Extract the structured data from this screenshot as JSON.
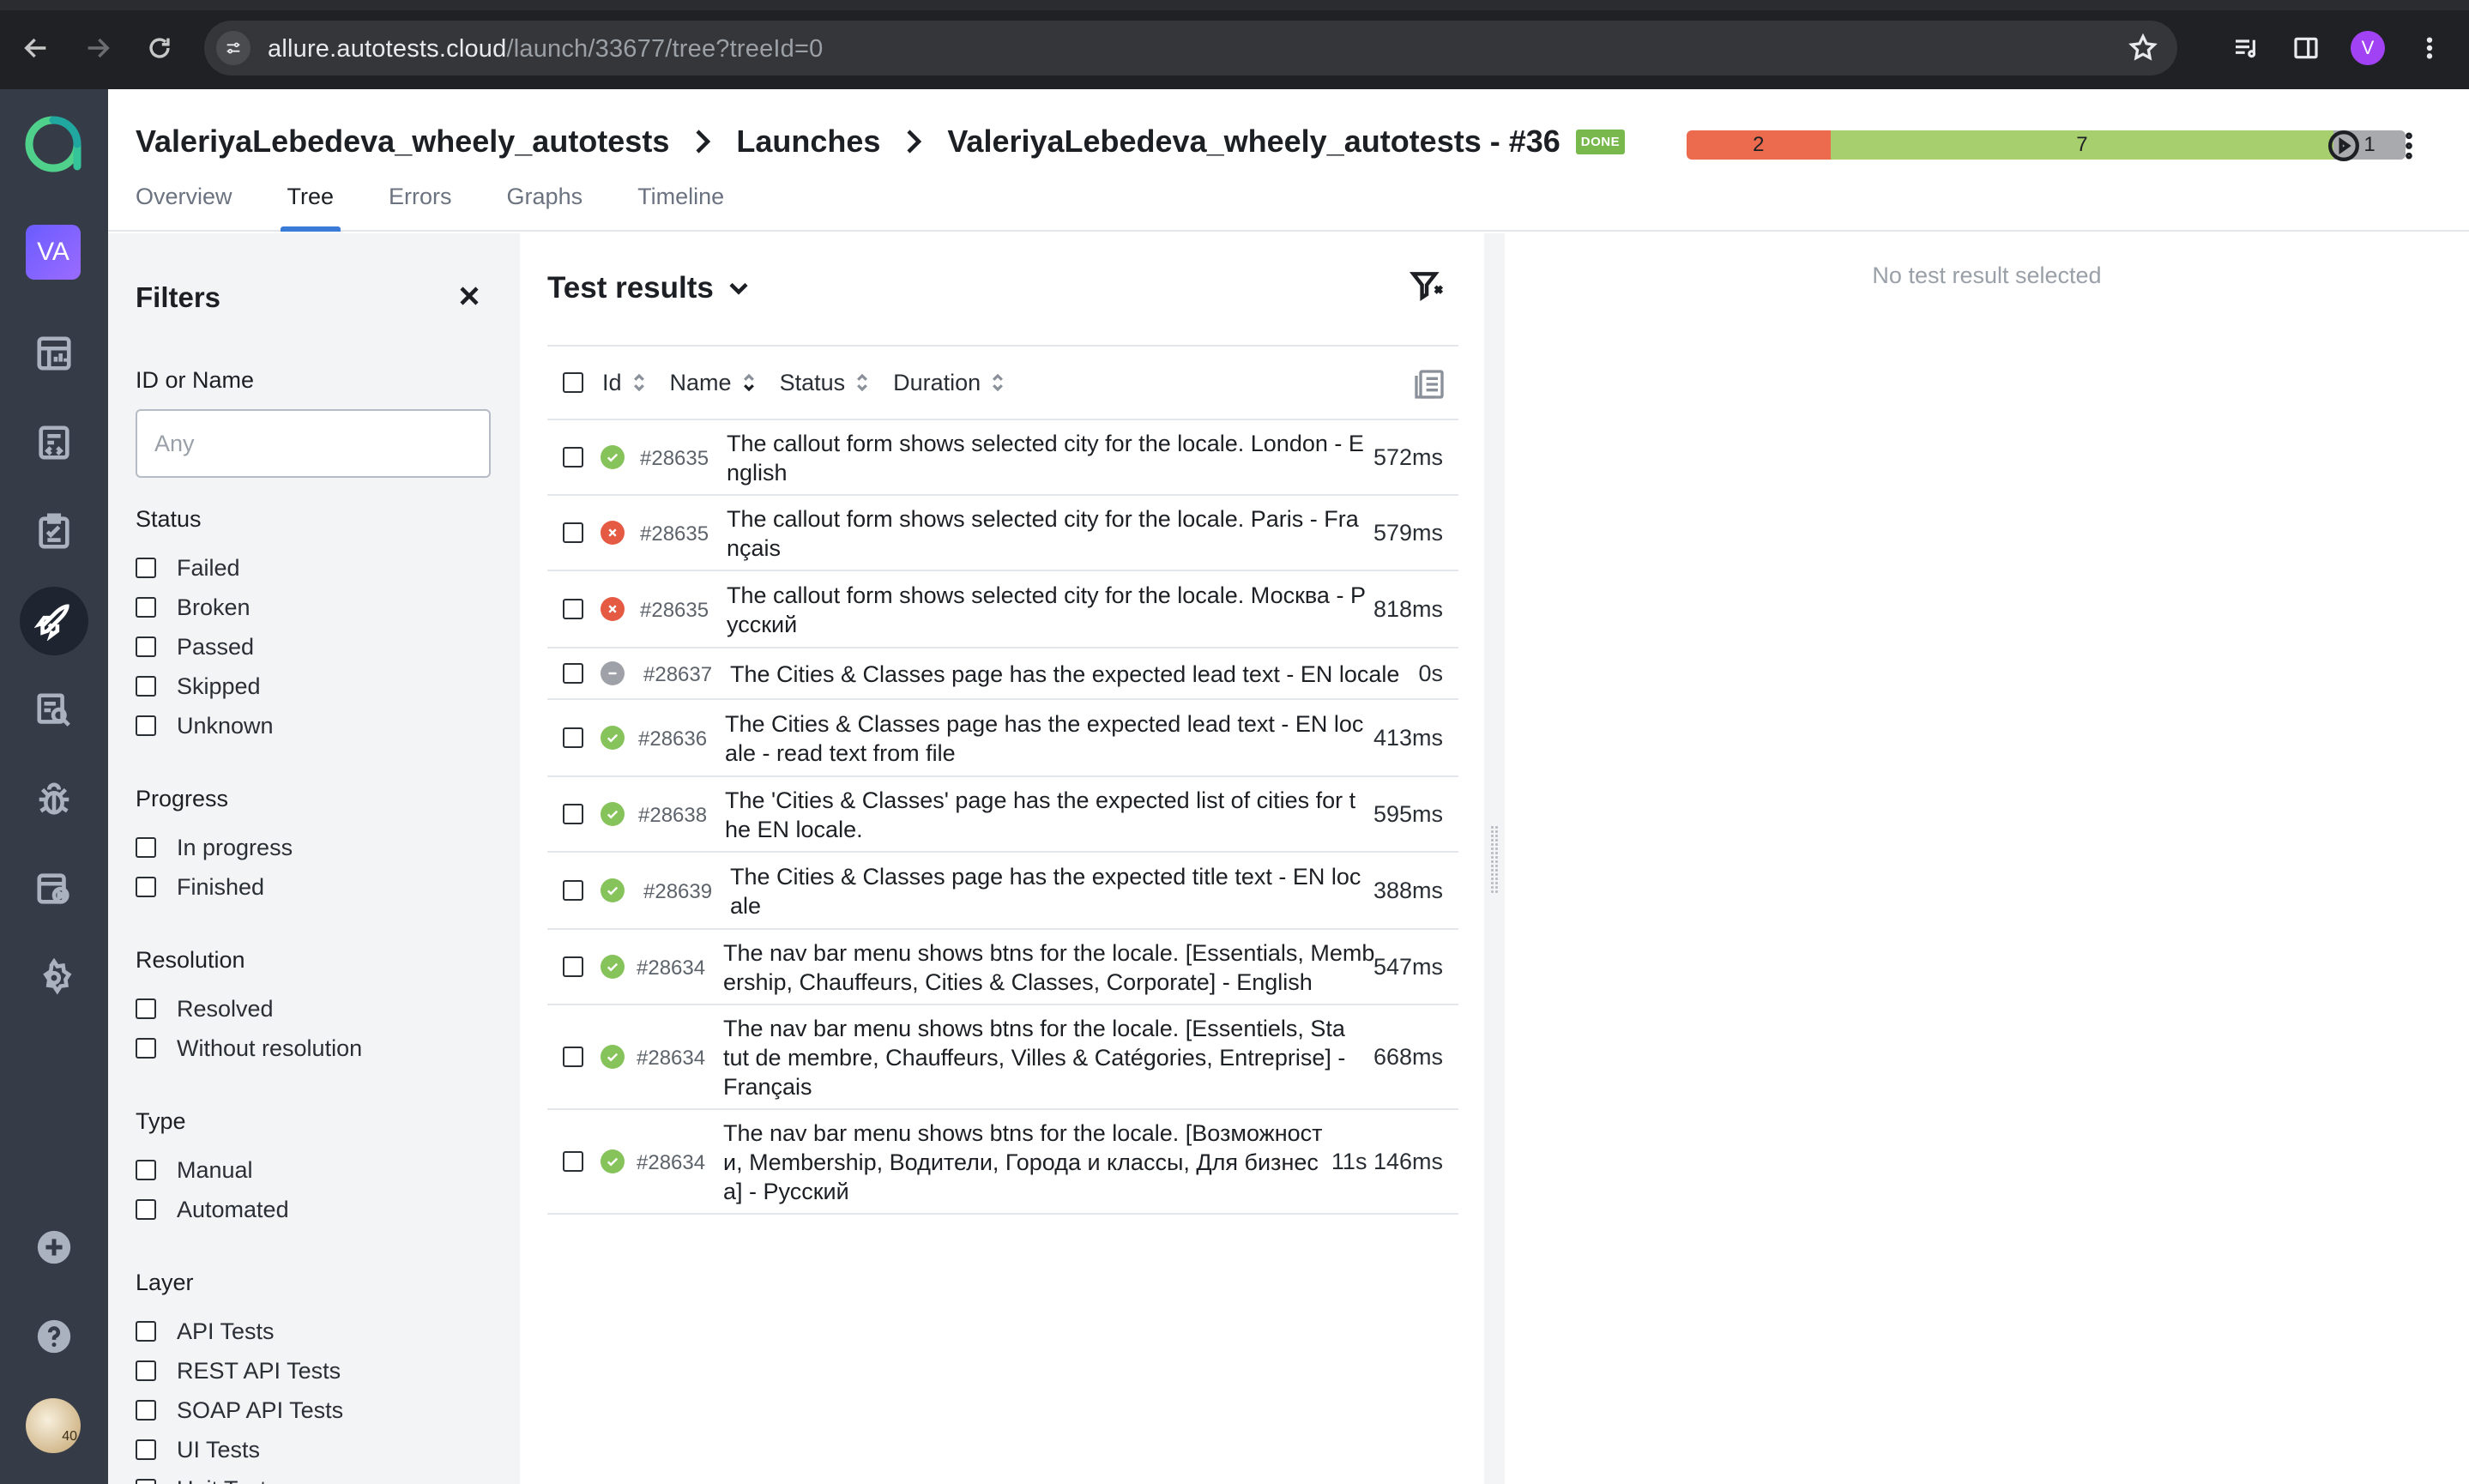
{
  "browser": {
    "url_host": "allure.autotests.cloud",
    "url_path": "/launch/33677/tree?treeId=0",
    "profile_initial": "V"
  },
  "rail": {
    "workspace_initials": "VA",
    "avatar_badge": "40",
    "items": [
      {
        "name": "dashboards-icon"
      },
      {
        "name": "test-cases-icon"
      },
      {
        "name": "test-plans-icon"
      },
      {
        "name": "launches-icon",
        "active": true
      },
      {
        "name": "analytics-icon"
      },
      {
        "name": "defects-icon"
      },
      {
        "name": "jobs-icon"
      },
      {
        "name": "settings-icon"
      }
    ]
  },
  "header": {
    "crumbs": [
      "ValeriyaLebedeva_wheely_autotests",
      "Launches",
      "ValeriyaLebedeva_wheely_autotests - #36"
    ],
    "badge": "DONE",
    "stats": {
      "failed": 2,
      "passed": 7,
      "skipped": 1
    },
    "colors": {
      "failed": "#ec6a4e",
      "passed": "#a8cf6e",
      "skipped": "#a8aaae",
      "accent": "#3b7bd8"
    },
    "tabs": [
      "Overview",
      "Tree",
      "Errors",
      "Graphs",
      "Timeline"
    ],
    "active_tab": "Tree"
  },
  "filters": {
    "title": "Filters",
    "id_label": "ID or Name",
    "id_placeholder": "Any",
    "groups": [
      {
        "label": "Status",
        "options": [
          "Failed",
          "Broken",
          "Passed",
          "Skipped",
          "Unknown"
        ]
      },
      {
        "label": "Progress",
        "options": [
          "In progress",
          "Finished"
        ]
      },
      {
        "label": "Resolution",
        "options": [
          "Resolved",
          "Without resolution"
        ]
      },
      {
        "label": "Type",
        "options": [
          "Manual",
          "Automated"
        ]
      },
      {
        "label": "Layer",
        "options": [
          "API Tests",
          "REST API Tests",
          "SOAP API Tests",
          "UI Tests",
          "Unit Tests"
        ]
      }
    ]
  },
  "results": {
    "title": "Test results",
    "columns": [
      "Id",
      "Name",
      "Status",
      "Duration"
    ],
    "rows": [
      {
        "status": "passed",
        "id": "#28635",
        "name": "The callout form shows selected city for the locale. London - English",
        "duration": "572ms"
      },
      {
        "status": "failed",
        "id": "#28635",
        "name": "The callout form shows selected city for the locale. Paris - Français",
        "duration": "579ms"
      },
      {
        "status": "failed",
        "id": "#28635",
        "name": "The callout form shows selected city for the locale. Москва - Русский",
        "duration": "818ms"
      },
      {
        "status": "skipped",
        "id": "#28637",
        "name": "The Cities & Classes page has the expected lead text - EN locale",
        "duration": "0s"
      },
      {
        "status": "passed",
        "id": "#28636",
        "name": "The Cities & Classes page has the expected lead text - EN locale - read text from file",
        "duration": "413ms"
      },
      {
        "status": "passed",
        "id": "#28638",
        "name": "The 'Cities & Classes' page has the expected list of cities for the EN locale.",
        "duration": "595ms"
      },
      {
        "status": "passed",
        "id": "#28639",
        "name": "The Cities & Classes page has the expected title text - EN locale",
        "duration": "388ms"
      },
      {
        "status": "passed",
        "id": "#28634",
        "name": "The nav bar menu shows btns for the locale. [Essentials, Membership, Chauffeurs, Cities & Classes, Corporate] - English",
        "duration": "547ms"
      },
      {
        "status": "passed",
        "id": "#28634",
        "name": "The nav bar menu shows btns for the locale. [Essentiels, Statut de membre, Chauffeurs, Villes & Catégories, Entreprise] - Français",
        "duration": "668ms"
      },
      {
        "status": "passed",
        "id": "#28634",
        "name": "The nav bar menu shows btns for the locale. [Возможности, Membership, Водители, Города и классы, Для бизнеса] - Русский",
        "duration": "11s 146ms"
      }
    ]
  },
  "detail": {
    "empty_text": "No test result selected"
  }
}
